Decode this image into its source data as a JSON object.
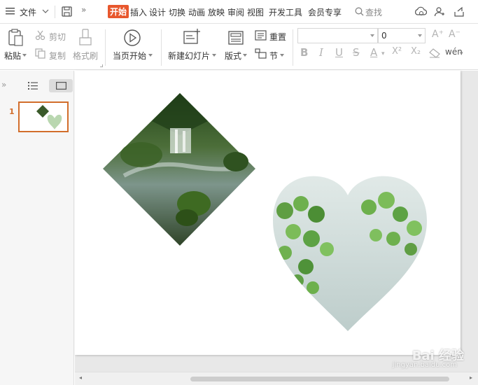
{
  "menu": {
    "file": "文件",
    "tabs": [
      "开始",
      "插入",
      "设计",
      "切换",
      "动画",
      "放映",
      "审阅",
      "视图",
      "开发工具",
      "会员专享"
    ],
    "search": "查找"
  },
  "ribbon": {
    "paste": "粘贴",
    "cut": "剪切",
    "copy": "复制",
    "format_painter": "格式刷",
    "play_from_current": "当页开始",
    "new_slide": "新建幻灯片",
    "layout": "版式",
    "reset": "重置",
    "section": "节",
    "font_name": "",
    "font_size": "0"
  },
  "slides_panel": {
    "slide_number": "1"
  },
  "watermark": {
    "line1": "Bai 经验",
    "line2": "jingyan.baidu.com"
  }
}
